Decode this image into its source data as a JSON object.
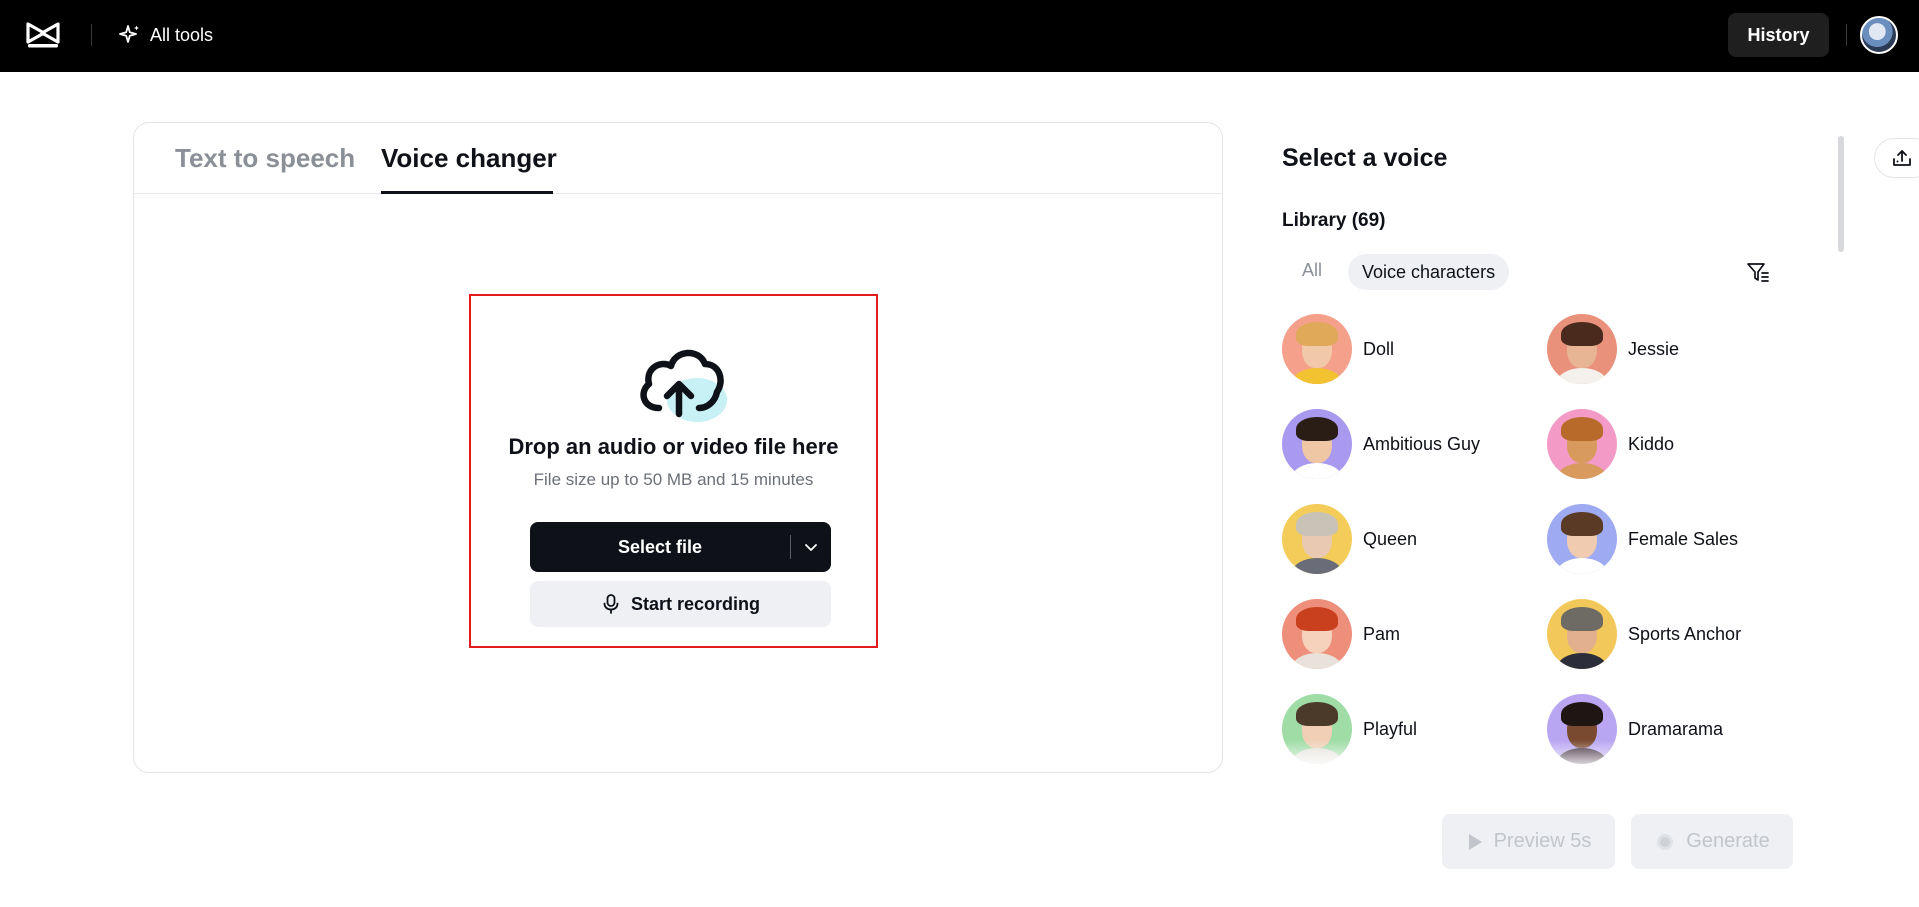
{
  "header": {
    "logo_icon": "capcut-logo-icon",
    "all_tools_label": "All tools",
    "history_label": "History"
  },
  "tabs": [
    {
      "label": "Text to speech",
      "active": false
    },
    {
      "label": "Voice changer",
      "active": true
    }
  ],
  "dropzone": {
    "icon": "cloud-upload-icon",
    "title": "Drop an audio or video file here",
    "subtitle": "File size up to 50 MB and 15 minutes",
    "select_label": "Select file",
    "record_label": "Start recording"
  },
  "voice_panel": {
    "title": "Select a voice",
    "library_label": "Library (69)",
    "filters": [
      "All",
      "Voice characters"
    ],
    "active_filter": "Voice characters",
    "voices": [
      {
        "name": "Doll",
        "bg": "#f4a08a"
      },
      {
        "name": "Jessie",
        "bg": "#e9917a"
      },
      {
        "name": "Ambitious Guy",
        "bg": "#a99af0"
      },
      {
        "name": "Kiddo",
        "bg": "#f39ac6"
      },
      {
        "name": "Queen",
        "bg": "#f3cc5a"
      },
      {
        "name": "Female Sales",
        "bg": "#9eaaf2"
      },
      {
        "name": "Pam",
        "bg": "#ee8f7c"
      },
      {
        "name": "Sports Anchor",
        "bg": "#f3c85a"
      },
      {
        "name": "Playful",
        "bg": "#9fdca6"
      },
      {
        "name": "Dramarama",
        "bg": "#b9a6f2"
      }
    ]
  },
  "actions": {
    "preview_label": "Preview 5s",
    "generate_label": "Generate"
  },
  "colors": {
    "topbar": "#000000",
    "highlight_border": "#e31b1b",
    "primary_button": "#0e1118",
    "disabled_button": "#eef0f3"
  }
}
